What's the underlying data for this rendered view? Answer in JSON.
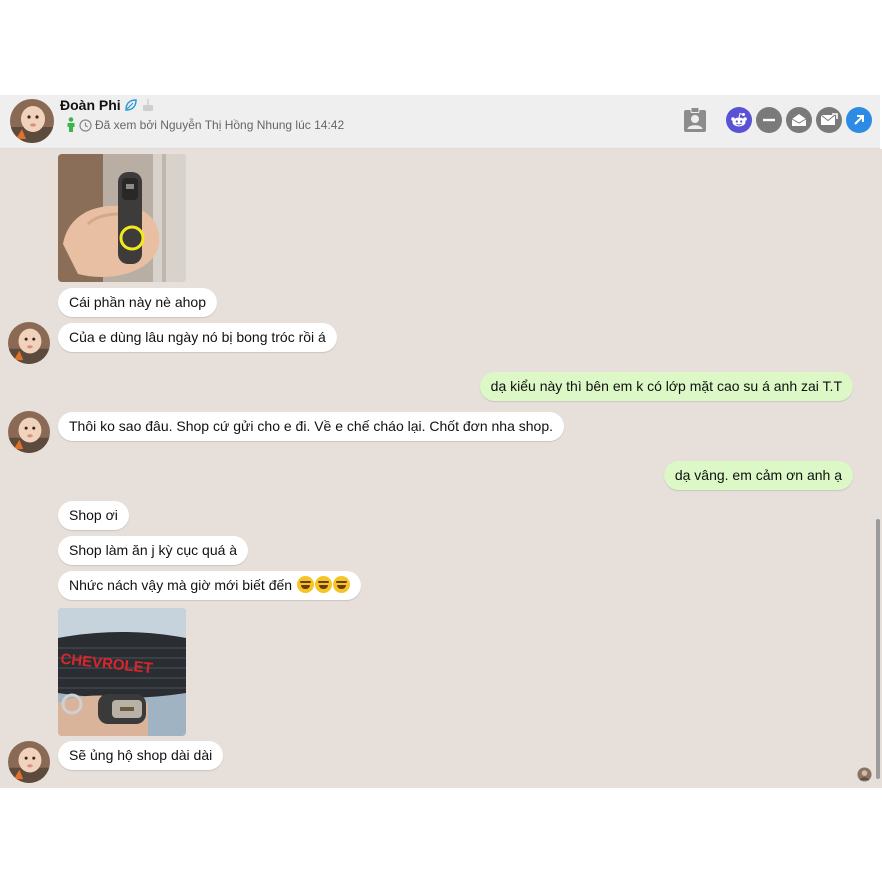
{
  "header": {
    "name": "Đoàn Phi",
    "seen_status": "Đã xem bởi Nguyễn Thị Hồng Nhung lúc 14:42",
    "icons": [
      "verified-leaf-icon",
      "cake-icon",
      "online-person-icon",
      "clock-icon",
      "contact-card-icon",
      "reddit-icon",
      "minimize-icon",
      "mail-open-icon",
      "mail-forward-icon",
      "open-external-icon"
    ],
    "colors": {
      "reddit": "#5a52d5",
      "grey_buttons": "#7a7a7a",
      "external": "#2d8be6",
      "online": "#3bb54a"
    }
  },
  "messages": [
    {
      "side": "in",
      "type": "image",
      "caption": "car key in hand photo"
    },
    {
      "side": "in",
      "text": "Cái phần này nè ahop"
    },
    {
      "side": "in",
      "text": "Của e dùng lâu ngày nó bị bong tróc rồi á"
    },
    {
      "side": "out",
      "text": "dạ kiểu này thì bên em k có lớp mặt cao su á anh zai T.T"
    },
    {
      "side": "in",
      "text": "Thôi ko sao đâu. Shop cứ gửi cho e đi. Về e chế cháo lại. Chốt đơn nha shop."
    },
    {
      "side": "out",
      "text": "dạ vâng. em cảm ơn anh ạ"
    },
    {
      "side": "in",
      "text": "Shop ơi"
    },
    {
      "side": "in",
      "text": "Shop làm ăn j kỳ cục quá à"
    },
    {
      "side": "in",
      "text": "Nhức nách vậy mà giờ mới biết đến"
    },
    {
      "side": "in",
      "type": "image",
      "image_text": "CHEVROLET"
    },
    {
      "side": "in",
      "text": "Sẽ ủng hộ shop dài dài"
    }
  ],
  "colors": {
    "chat_bg": "#e6dfda",
    "incoming": "#ffffff",
    "outgoing": "#dcf8c6"
  }
}
